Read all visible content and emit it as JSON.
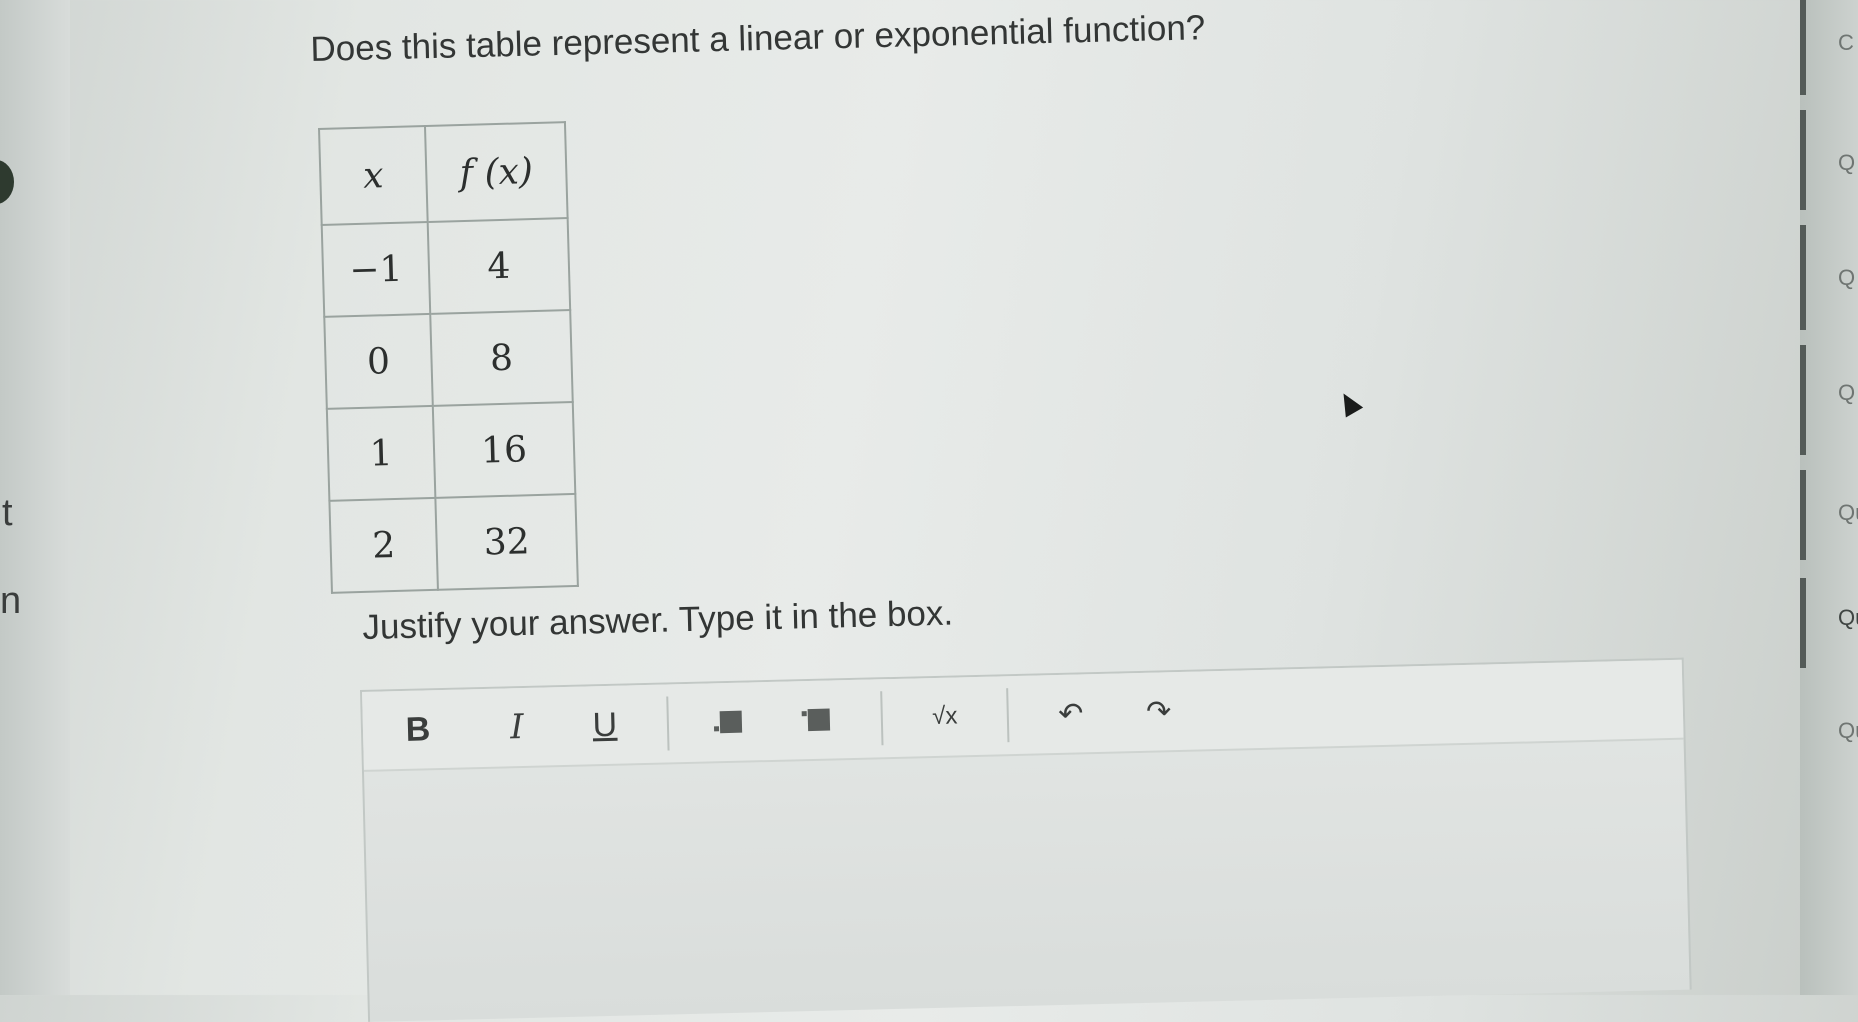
{
  "question": "Does this table represent a linear or exponential function?",
  "table": {
    "headers": [
      "x",
      "f (x)"
    ],
    "rows": [
      [
        "−1",
        "4"
      ],
      [
        "0",
        "8"
      ],
      [
        "1",
        "16"
      ],
      [
        "2",
        "32"
      ]
    ]
  },
  "prompt": "Justify your answer. Type it in the box.",
  "toolbar": {
    "bold": "B",
    "italic": "I",
    "underline": "U",
    "sqrt": "√x",
    "undo": "↶",
    "redo": "↷"
  },
  "left_fragments": [
    "t",
    "n"
  ],
  "question_nav": [
    "C",
    "Q",
    "Q",
    "Q",
    "Qu",
    "Qu",
    "Qu"
  ]
}
